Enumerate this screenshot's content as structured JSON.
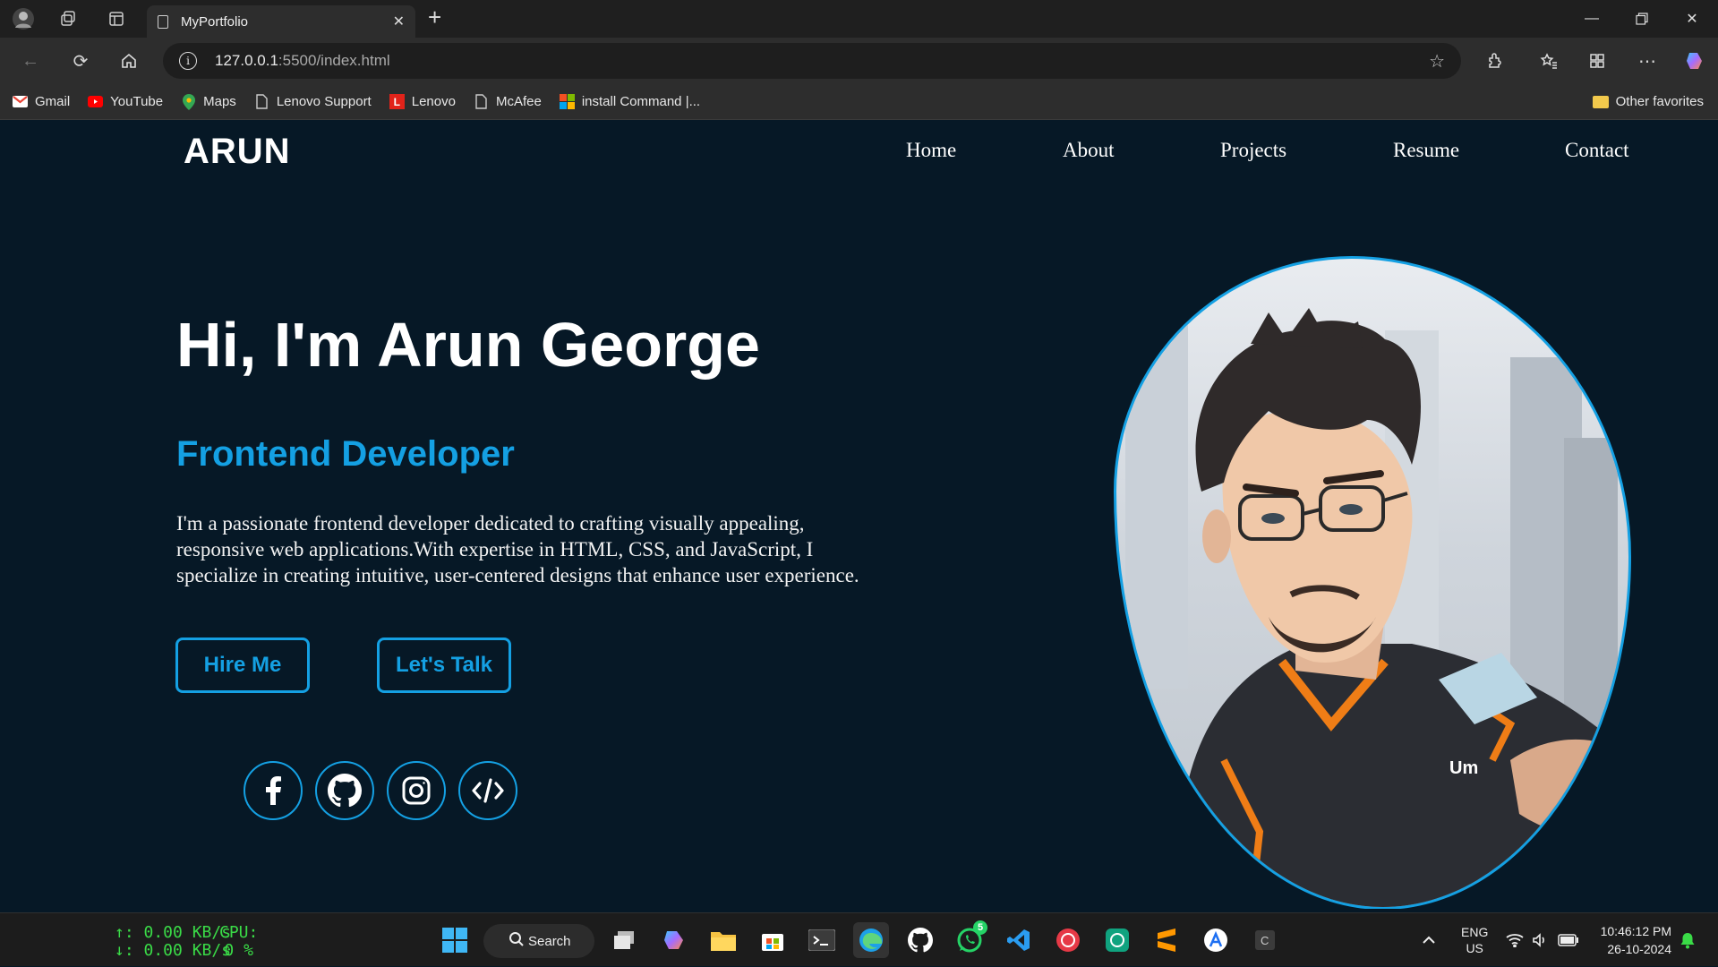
{
  "browser": {
    "tab_title": "MyPortfolio",
    "url_host": "127.0.0.1",
    "url_rest": ":5500/index.html",
    "bookmarks": [
      "Gmail",
      "YouTube",
      "Maps",
      "Lenovo Support",
      "Lenovo",
      "McAfee",
      "install Command |..."
    ],
    "other_favorites": "Other favorites"
  },
  "site": {
    "logo": "ARUN",
    "nav": [
      "Home",
      "About",
      "Projects",
      "Resume",
      "Contact"
    ],
    "hero": {
      "title": "Hi, I'm Arun George",
      "subtitle": "Frontend Developer",
      "description": "I'm a passionate frontend developer dedicated to crafting visually appealing, responsive web applications.With expertise in HTML, CSS, and JavaScript, I specialize in creating intuitive, user-centered designs that enhance user experience.",
      "hire_label": "Hire Me",
      "talk_label": "Let's Talk",
      "avatar_overlay_text": "Um"
    },
    "social_icons": [
      "facebook-icon",
      "github-icon",
      "instagram-icon",
      "code-icon"
    ],
    "accent_color": "#14a0e3",
    "background_color": "#061826"
  },
  "taskbar": {
    "net_up": "↑: 0.00 KB/s",
    "net_down": "↓: 0.00 KB/s",
    "cpu_label": "CPU:",
    "cpu_value": "0 %",
    "search_label": "Search",
    "whatsapp_badge": "5",
    "lang_top": "ENG",
    "lang_bottom": "US",
    "time": "10:46:12 PM",
    "date": "26-10-2024"
  }
}
